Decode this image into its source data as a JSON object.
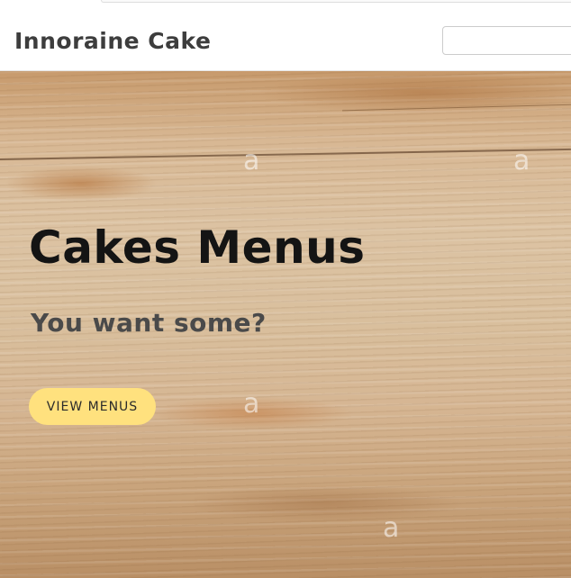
{
  "navbar": {
    "brand": "Innoraine Cake",
    "search_value": ""
  },
  "hero": {
    "title": "Cakes Menus",
    "subtitle": "You want some?",
    "cta_label": "VIEW MENUS",
    "cta_color": "#ffe17e"
  }
}
